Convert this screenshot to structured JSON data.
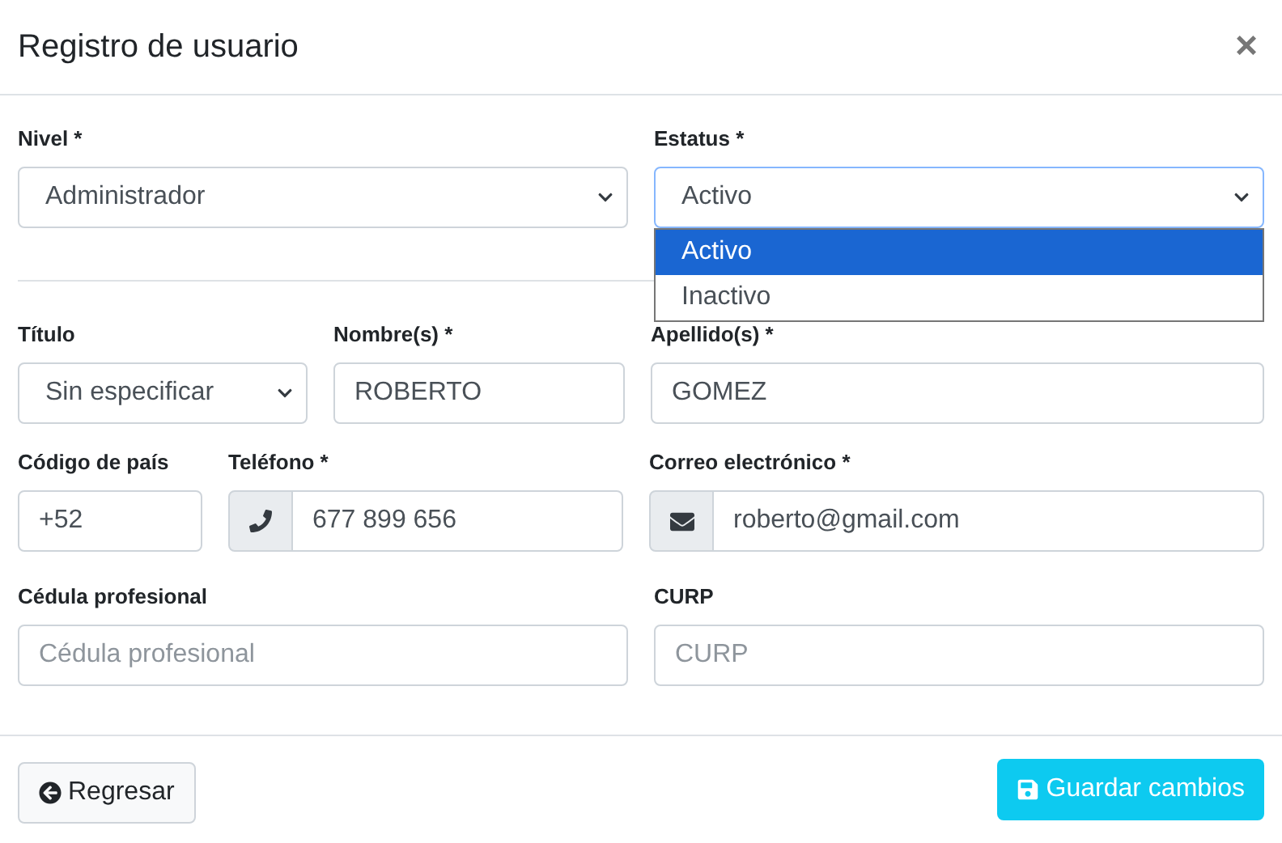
{
  "dialog": {
    "title": "Registro de usuario",
    "close": "×"
  },
  "nivel": {
    "label": "Nivel *",
    "value": "Administrador"
  },
  "estatus": {
    "label": "Estatus *",
    "value": "Activo",
    "expanded": true,
    "options": [
      {
        "label": "Activo",
        "selected": true
      },
      {
        "label": "Inactivo",
        "selected": false
      }
    ]
  },
  "titulo": {
    "label": "Título",
    "value": "Sin especificar"
  },
  "nombre": {
    "label": "Nombre(s) *",
    "value": "ROBERTO"
  },
  "apellido": {
    "label": "Apellido(s) *",
    "value": "GOMEZ"
  },
  "codigo": {
    "label": "Código de país",
    "value": "+52"
  },
  "telefono": {
    "label": "Teléfono *",
    "value": "677 899 656"
  },
  "correo": {
    "label": "Correo electrónico *",
    "value": "roberto@gmail.com"
  },
  "cedula": {
    "label": "Cédula profesional",
    "placeholder": "Cédula profesional"
  },
  "curp": {
    "label": "CURP",
    "placeholder": "CURP"
  },
  "buttons": {
    "back": "Regresar",
    "save": "Guardar cambios"
  }
}
